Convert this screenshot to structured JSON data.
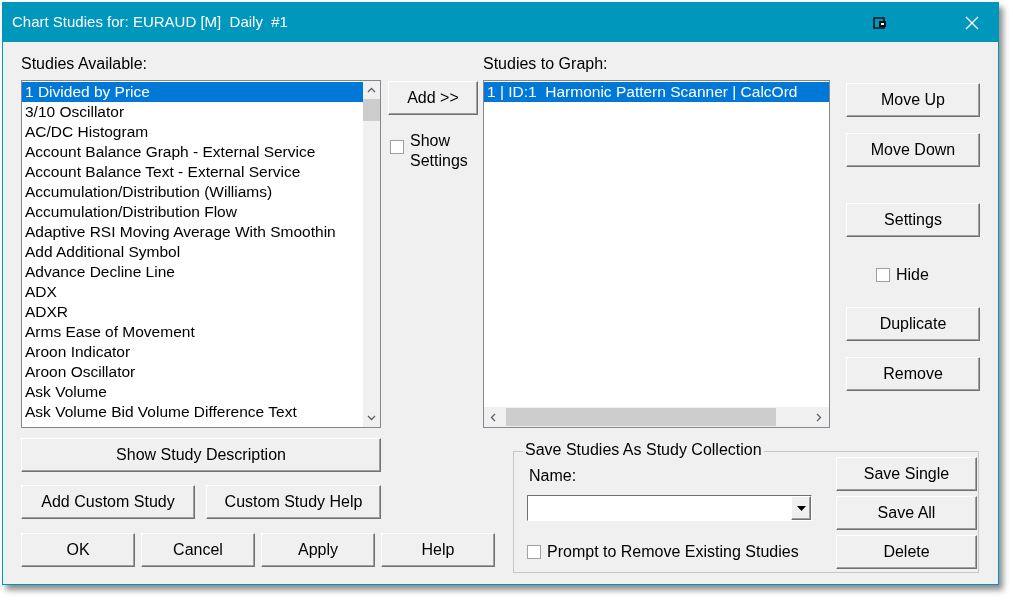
{
  "window": {
    "title": "Chart Studies for: EURAUD [M]  Daily  #1"
  },
  "available": {
    "label": "Studies Available:",
    "items": [
      {
        "text": "1 Divided by Price",
        "selected": true
      },
      {
        "text": "3/10 Oscillator",
        "selected": false
      },
      {
        "text": "AC/DC Histogram",
        "selected": false
      },
      {
        "text": "Account Balance Graph - External Service",
        "selected": false
      },
      {
        "text": "Account Balance Text - External Service",
        "selected": false
      },
      {
        "text": "Accumulation/Distribution (Williams)",
        "selected": false
      },
      {
        "text": "Accumulation/Distribution Flow",
        "selected": false
      },
      {
        "text": "Adaptive RSI Moving Average With Smoothin",
        "selected": false
      },
      {
        "text": "Add Additional Symbol",
        "selected": false
      },
      {
        "text": "Advance Decline Line",
        "selected": false
      },
      {
        "text": "ADX",
        "selected": false
      },
      {
        "text": "ADXR",
        "selected": false
      },
      {
        "text": "Arms Ease of Movement",
        "selected": false
      },
      {
        "text": "Aroon Indicator",
        "selected": false
      },
      {
        "text": "Aroon Oscillator",
        "selected": false
      },
      {
        "text": "Ask Volume",
        "selected": false
      },
      {
        "text": "Ask Volume Bid Volume Difference Text",
        "selected": false
      }
    ]
  },
  "add_button": "Add >>",
  "show_settings": {
    "label": "Show Settings",
    "checked": false
  },
  "graph": {
    "label": "Studies to Graph:",
    "items": [
      {
        "text": "1 | ID:1  Harmonic Pattern Scanner | CalcOrd",
        "selected": true
      }
    ]
  },
  "side_controls": [
    {
      "kind": "button",
      "label": "Move Up"
    },
    {
      "kind": "button",
      "label": "Move Down"
    },
    {
      "kind": "button",
      "label": "Settings"
    },
    {
      "kind": "checkbox",
      "label": "Hide",
      "checked": false
    },
    {
      "kind": "button",
      "label": "Duplicate"
    },
    {
      "kind": "button",
      "label": "Remove"
    }
  ],
  "description_button": "Show Study Description",
  "custom_buttons": [
    "Add Custom Study",
    "Custom Study Help"
  ],
  "dialog_buttons": [
    "OK",
    "Cancel",
    "Apply",
    "Help"
  ],
  "collection": {
    "title": "Save Studies As Study Collection",
    "name_label": "Name:",
    "prompt": {
      "label": "Prompt to Remove Existing Studies",
      "checked": false
    },
    "buttons": [
      "Save Single",
      "Save All",
      "Delete"
    ]
  }
}
